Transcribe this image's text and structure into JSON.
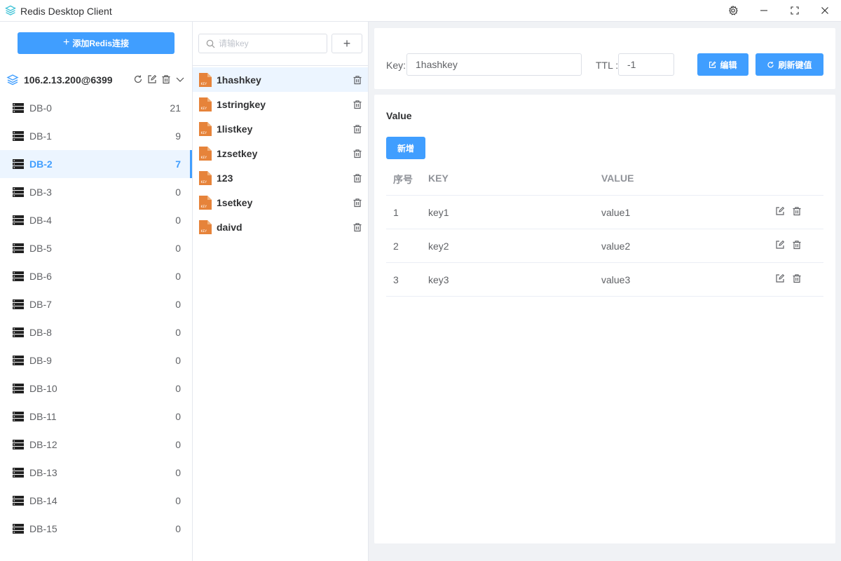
{
  "window": {
    "title": "Redis Desktop Client",
    "controls": [
      "settings-icon",
      "minimize-icon",
      "maximize-icon",
      "close-icon"
    ]
  },
  "sidebar": {
    "add_button_label": "添加Redis连接",
    "connection": {
      "name": "106.2.13.200@6399",
      "actions": [
        "refresh-icon",
        "edit-icon",
        "trash-icon",
        "chevron-down-icon"
      ]
    },
    "databases": [
      {
        "name": "DB-0",
        "count": "21"
      },
      {
        "name": "DB-1",
        "count": "9"
      },
      {
        "name": "DB-2",
        "count": "7",
        "active": true
      },
      {
        "name": "DB-3",
        "count": "0"
      },
      {
        "name": "DB-4",
        "count": "0"
      },
      {
        "name": "DB-5",
        "count": "0"
      },
      {
        "name": "DB-6",
        "count": "0"
      },
      {
        "name": "DB-7",
        "count": "0"
      },
      {
        "name": "DB-8",
        "count": "0"
      },
      {
        "name": "DB-9",
        "count": "0"
      },
      {
        "name": "DB-10",
        "count": "0"
      },
      {
        "name": "DB-11",
        "count": "0"
      },
      {
        "name": "DB-12",
        "count": "0"
      },
      {
        "name": "DB-13",
        "count": "0"
      },
      {
        "name": "DB-14",
        "count": "0"
      },
      {
        "name": "DB-15",
        "count": "0"
      }
    ]
  },
  "keylist": {
    "search_placeholder": "请输key",
    "search_value": "",
    "add_label": "+",
    "keys": [
      {
        "name": "1hashkey",
        "active": true
      },
      {
        "name": "1stringkey"
      },
      {
        "name": "1listkey"
      },
      {
        "name": "1zsetkey"
      },
      {
        "name": "123"
      },
      {
        "name": "1setkey"
      },
      {
        "name": "daivd"
      }
    ]
  },
  "detail": {
    "key_label": "Key:",
    "key_value": "1hashkey",
    "ttl_label": "TTL :",
    "ttl_value": "-1",
    "edit_button": "编辑",
    "refresh_button": "刷新键值",
    "value_title": "Value",
    "new_button": "新增",
    "table": {
      "headers": [
        "序号",
        "KEY",
        "VALUE"
      ],
      "rows": [
        {
          "index": "1",
          "key": "key1",
          "value": "value1"
        },
        {
          "index": "2",
          "key": "key2",
          "value": "value2"
        },
        {
          "index": "3",
          "key": "key3",
          "value": "value3"
        }
      ]
    }
  },
  "colors": {
    "primary": "#409eff",
    "key_icon": "#e6833a",
    "active_bg": "#ecf5ff",
    "page_bg": "#f0f2f5"
  }
}
